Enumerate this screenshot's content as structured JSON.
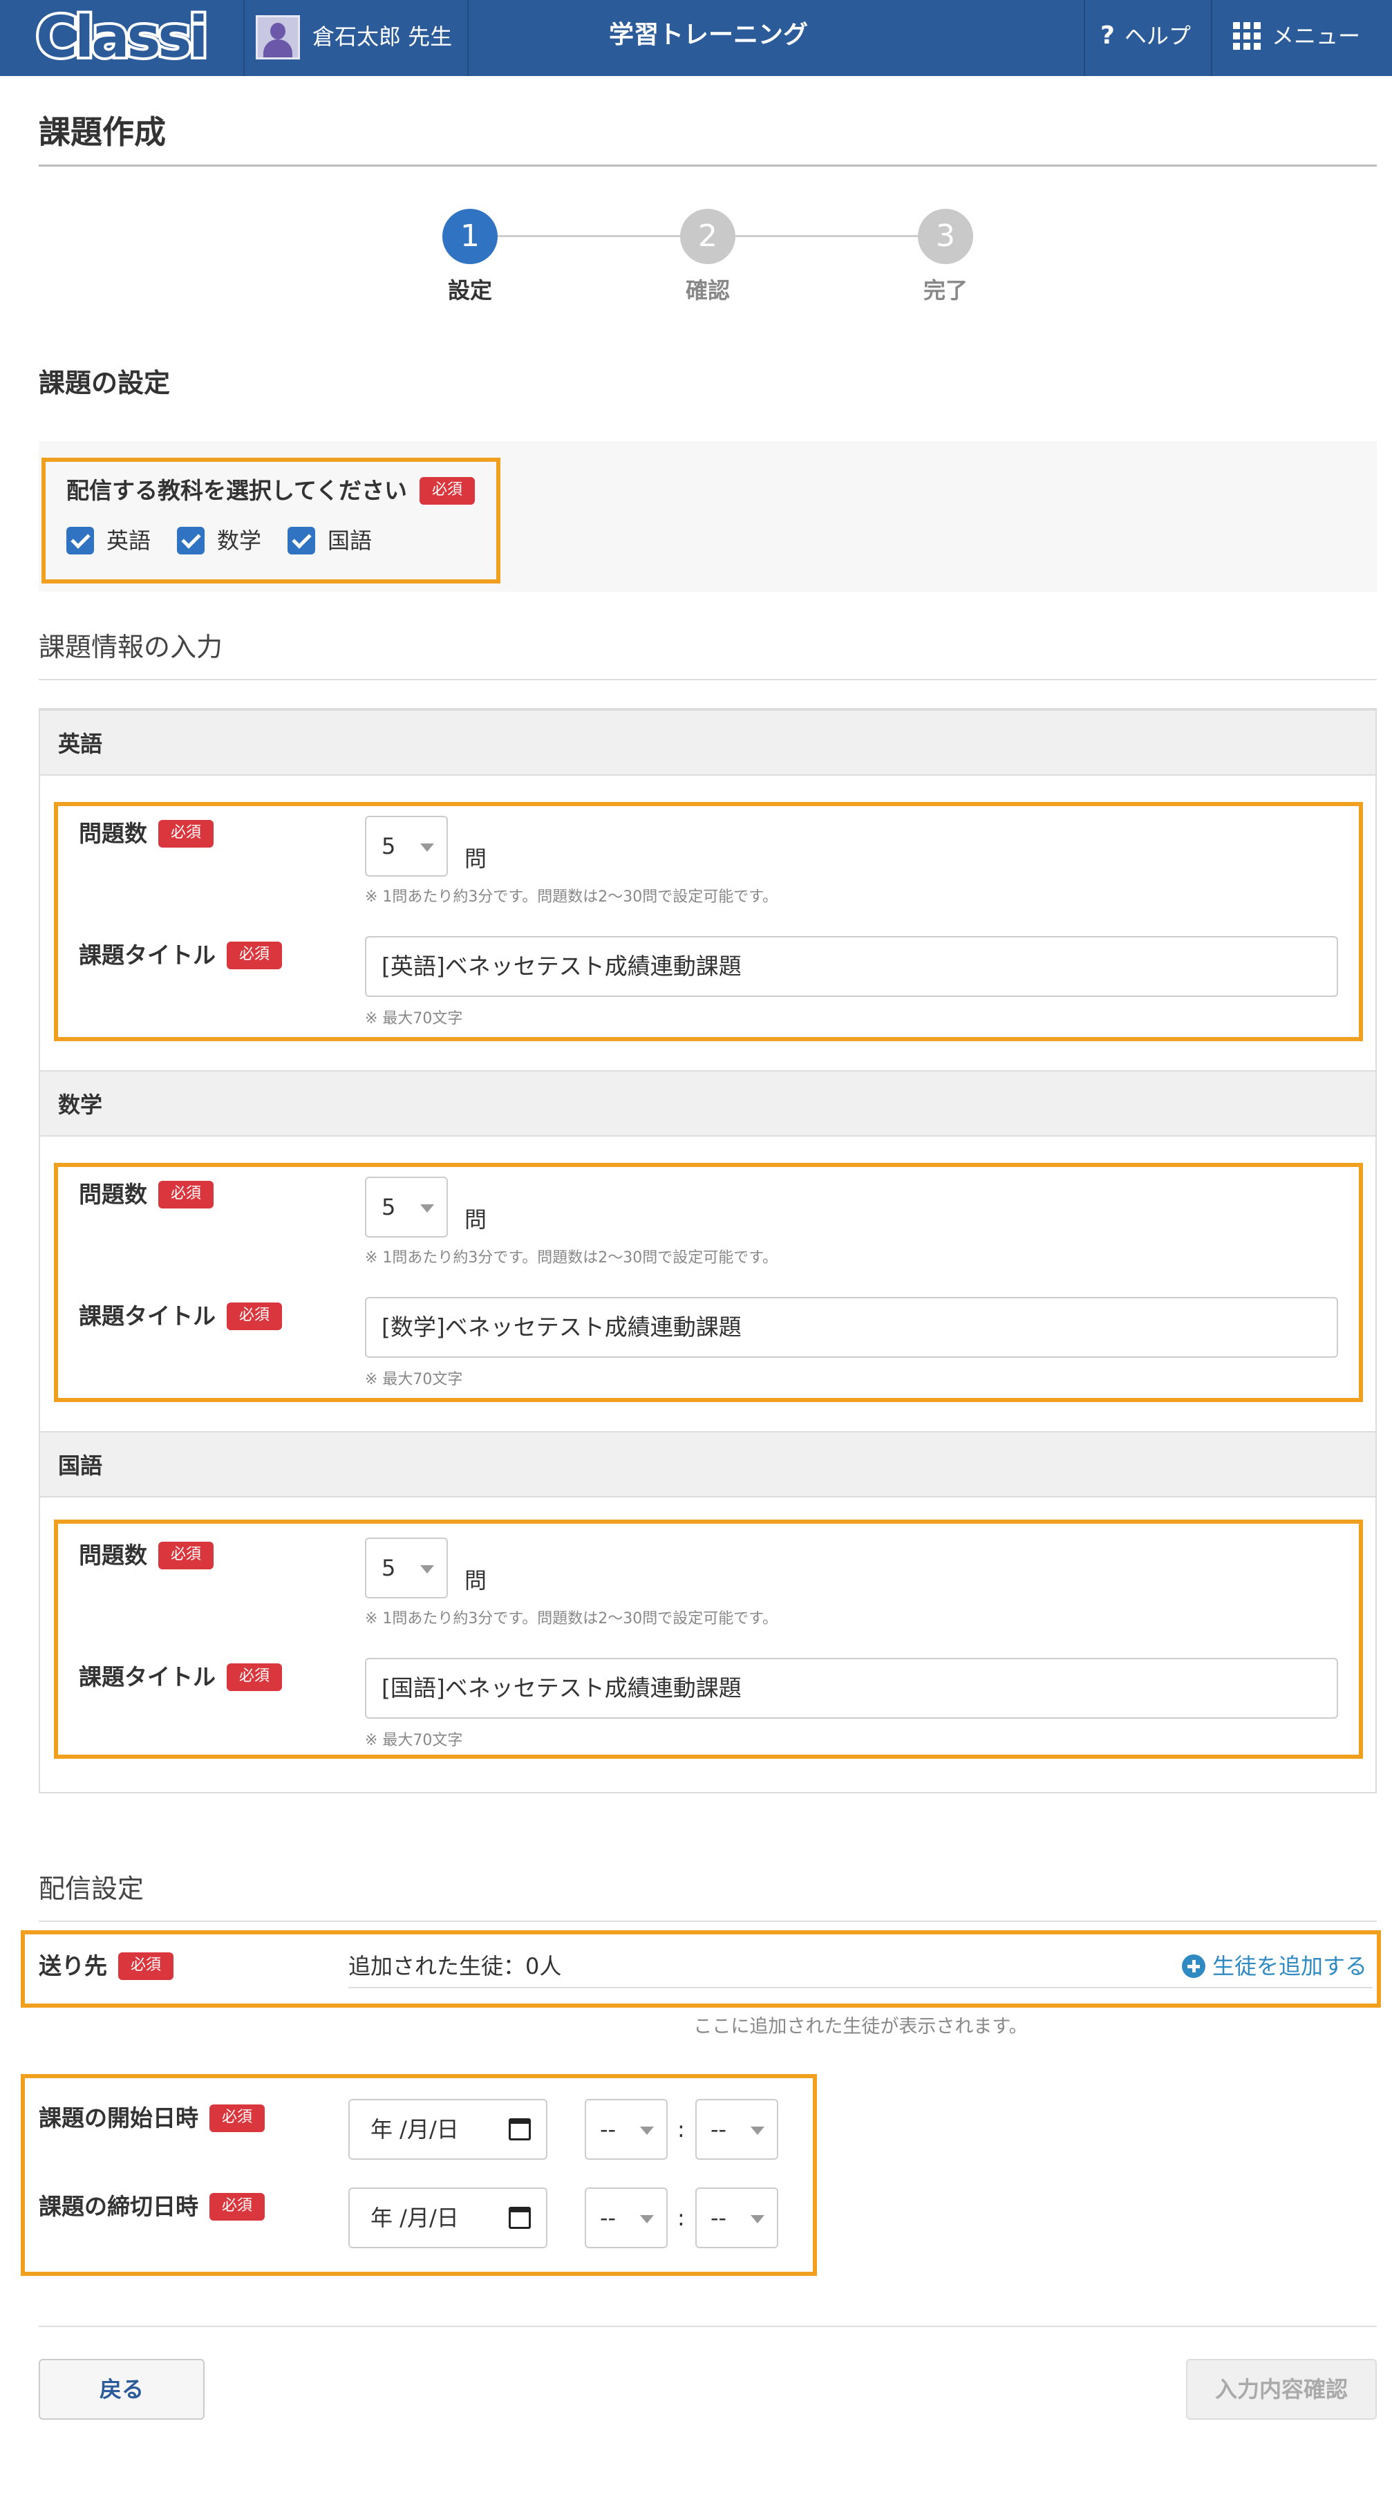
{
  "header": {
    "logo_text": "Classi",
    "teacher_name": "倉石太郎 先生",
    "app_title": "学習トレーニング",
    "help_label": "ヘルプ",
    "menu_label": "メニュー"
  },
  "page": {
    "title": "課題作成"
  },
  "stepper": {
    "steps": [
      {
        "number": "1",
        "label": "設定",
        "active": true
      },
      {
        "number": "2",
        "label": "確認",
        "active": false
      },
      {
        "number": "3",
        "label": "完了",
        "active": false
      }
    ]
  },
  "required_badge": "必須",
  "settings": {
    "section_title": "課題の設定",
    "subject_prompt": "配信する教科を選択してください",
    "subjects": [
      {
        "label": "英語",
        "checked": true
      },
      {
        "label": "数学",
        "checked": true
      },
      {
        "label": "国語",
        "checked": true
      }
    ]
  },
  "info": {
    "section_title": "課題情報の入力",
    "question_count_label": "問題数",
    "title_label": "課題タイトル",
    "unit": "問",
    "count_note": "※ 1問あたり約3分です。問題数は2〜30問で設定可能です。",
    "title_note": "※ 最大70文字",
    "subjects": [
      {
        "name": "英語",
        "count": "5",
        "title": "[英語]ベネッセテスト成績連動課題"
      },
      {
        "name": "数学",
        "count": "5",
        "title": "[数学]ベネッセテスト成績連動課題"
      },
      {
        "name": "国語",
        "count": "5",
        "title": "[国語]ベネッセテスト成績連動課題"
      }
    ]
  },
  "delivery": {
    "section_title": "配信設定",
    "destination_label": "送り先",
    "added_students": "追加された生徒：0人",
    "add_students_link": "生徒を追加する",
    "hint": "ここに追加された生徒が表示されます。",
    "start_label": "課題の開始日時",
    "end_label": "課題の締切日時",
    "date_placeholder": "年 /月/日",
    "time_placeholder": "--"
  },
  "footer": {
    "back_button": "戻る",
    "confirm_button": "入力内容確認"
  },
  "colors": {
    "header_bg": "#2b5b99",
    "accent_blue": "#2f73c2",
    "required_red": "#d9363e",
    "highlight_orange": "#f0a01e",
    "link_blue": "#2f8ac2"
  }
}
